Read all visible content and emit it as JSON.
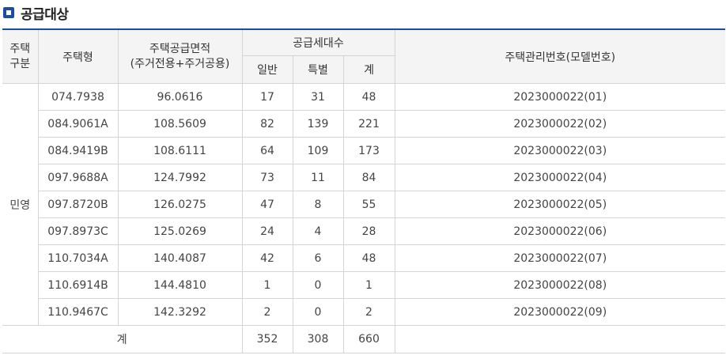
{
  "title": "공급대상",
  "table": {
    "headers": {
      "housing_type_group_l1": "주택",
      "housing_type_group_l2": "구분",
      "housing_model": "주택형",
      "area_l1": "주택공급면적",
      "area_l2": "(주거전용+주거공용)",
      "units": "공급세대수",
      "general": "일반",
      "special": "특별",
      "total": "계",
      "management_no": "주택관리번호(모델번호)"
    },
    "group_label": "민영",
    "rows": [
      {
        "model": "074.7938",
        "area": "96.0616",
        "general": "17",
        "special": "31",
        "total": "48",
        "code": "2023000022(01)"
      },
      {
        "model": "084.9061A",
        "area": "108.5609",
        "general": "82",
        "special": "139",
        "total": "221",
        "code": "2023000022(02)"
      },
      {
        "model": "084.9419B",
        "area": "108.6111",
        "general": "64",
        "special": "109",
        "total": "173",
        "code": "2023000022(03)"
      },
      {
        "model": "097.9688A",
        "area": "124.7992",
        "general": "73",
        "special": "11",
        "total": "84",
        "code": "2023000022(04)"
      },
      {
        "model": "097.8720B",
        "area": "126.0275",
        "general": "47",
        "special": "8",
        "total": "55",
        "code": "2023000022(05)"
      },
      {
        "model": "097.8973C",
        "area": "125.0269",
        "general": "24",
        "special": "4",
        "total": "28",
        "code": "2023000022(06)"
      },
      {
        "model": "110.7034A",
        "area": "140.4087",
        "general": "42",
        "special": "6",
        "total": "48",
        "code": "2023000022(07)"
      },
      {
        "model": "110.6914B",
        "area": "144.4810",
        "general": "1",
        "special": "0",
        "total": "1",
        "code": "2023000022(08)"
      },
      {
        "model": "110.9467C",
        "area": "142.3292",
        "general": "2",
        "special": "0",
        "total": "2",
        "code": "2023000022(09)"
      }
    ],
    "footer": {
      "label": "계",
      "general": "352",
      "special": "308",
      "total": "660",
      "code": ""
    }
  }
}
